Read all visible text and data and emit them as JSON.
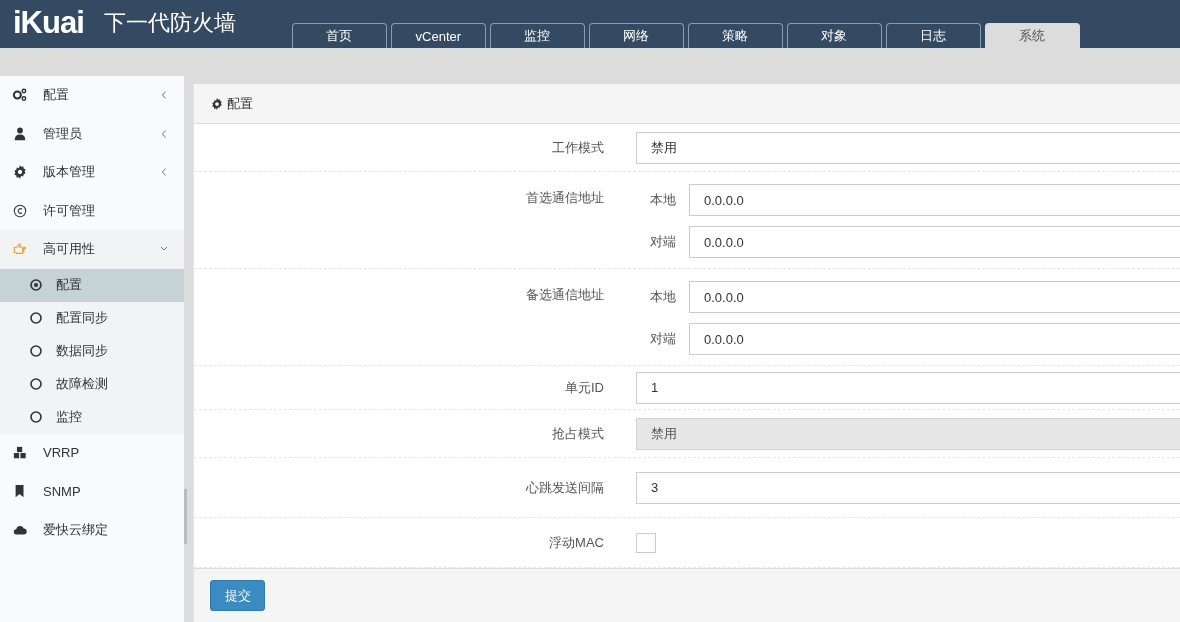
{
  "header": {
    "logo": "iKuai",
    "product": "下一代防火墙"
  },
  "nav_tabs": [
    {
      "label": "首页",
      "selected": false
    },
    {
      "label": "vCenter",
      "selected": false
    },
    {
      "label": "监控",
      "selected": false
    },
    {
      "label": "网络",
      "selected": false
    },
    {
      "label": "策略",
      "selected": false
    },
    {
      "label": "对象",
      "selected": false
    },
    {
      "label": "日志",
      "selected": false
    },
    {
      "label": "系统",
      "selected": true
    }
  ],
  "sidebar": {
    "items": [
      {
        "label": "配置",
        "expanded": false
      },
      {
        "label": "管理员",
        "expanded": false
      },
      {
        "label": "版本管理",
        "expanded": false
      },
      {
        "label": "许可管理"
      },
      {
        "label": "高可用性",
        "expanded": true,
        "children": [
          {
            "label": "配置",
            "selected": true
          },
          {
            "label": "配置同步",
            "selected": false
          },
          {
            "label": "数据同步",
            "selected": false
          },
          {
            "label": "故障检测",
            "selected": false
          },
          {
            "label": "监控",
            "selected": false
          }
        ]
      },
      {
        "label": "VRRP"
      },
      {
        "label": "SNMP"
      },
      {
        "label": "爱快云绑定"
      }
    ]
  },
  "panel": {
    "title": "配置",
    "rows": [
      {
        "kind": "select",
        "label": "工作模式",
        "value": "禁用",
        "disabled": false
      },
      {
        "kind": "address",
        "label": "首选通信地址",
        "fields": [
          {
            "label": "本地",
            "value": "0.0.0.0"
          },
          {
            "label": "对端",
            "value": "0.0.0.0"
          }
        ]
      },
      {
        "kind": "address",
        "label": "备选通信地址",
        "fields": [
          {
            "label": "本地",
            "value": "0.0.0.0"
          },
          {
            "label": "对端",
            "value": "0.0.0.0"
          }
        ]
      },
      {
        "kind": "input",
        "label": "单元ID",
        "value": "1"
      },
      {
        "kind": "select",
        "label": "抢占模式",
        "value": "禁用",
        "disabled": true
      },
      {
        "kind": "input",
        "label": "心跳发送间隔",
        "value": "3"
      },
      {
        "kind": "checkbox",
        "label": "浮动MAC",
        "checked": false
      }
    ],
    "submit": "提交"
  }
}
